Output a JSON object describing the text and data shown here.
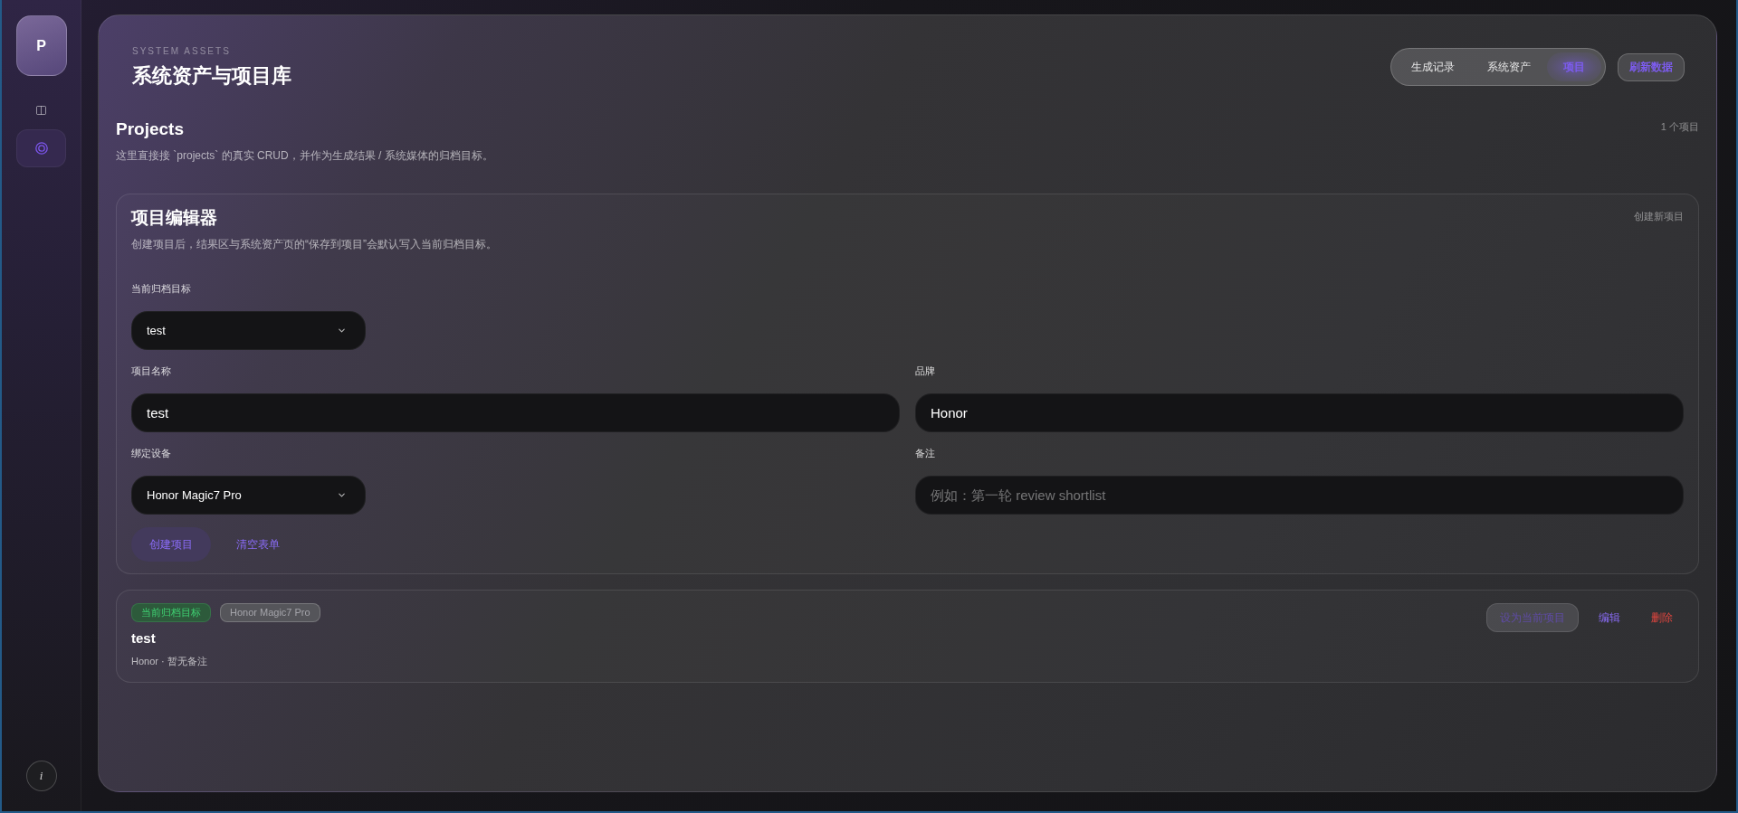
{
  "sidebar": {
    "logo": "P",
    "items": [
      {
        "kind": "columns",
        "selected": false
      },
      {
        "kind": "target",
        "selected": true
      }
    ],
    "info": "i"
  },
  "header": {
    "eyebrow": "SYSTEM ASSETS",
    "title": "系统资产与项目库",
    "tabs": [
      {
        "label": "生成记录",
        "selected": false
      },
      {
        "label": "系统资产",
        "selected": false
      },
      {
        "label": "项目",
        "selected": true
      }
    ],
    "refresh_button": "刷新数据"
  },
  "section": {
    "title": "Projects",
    "description": "这里直接接 `projects` 的真实 CRUD，并作为生成结果 / 系统媒体的归档目标。",
    "count": "1 个项目"
  },
  "editor": {
    "title": "项目编辑器",
    "description": "创建项目后，结果区与系统资产页的“保存到项目”会默认写入当前归档目标。",
    "new_link": "创建新项目",
    "archive_target": {
      "label": "当前归档目标",
      "value": "test"
    },
    "fields": [
      {
        "kind": "input",
        "label": "项目名称",
        "value": "test"
      },
      {
        "kind": "input",
        "label": "品牌",
        "value": "Honor"
      },
      {
        "kind": "select",
        "label": "绑定设备",
        "value": "Honor Magic7 Pro"
      },
      {
        "kind": "input",
        "label": "备注",
        "placeholder": "例如：第一轮 review shortlist"
      }
    ],
    "buttons": [
      {
        "kind": "primary",
        "label": "创建项目"
      },
      {
        "kind": "link",
        "label": "清空表单"
      }
    ]
  },
  "projects": [
    {
      "name": "test",
      "badges": [
        {
          "kind": "current",
          "label": "当前归档目标"
        },
        {
          "kind": "device",
          "label": "Honor Magic7 Pro"
        }
      ],
      "meta": "Honor · 暂无备注",
      "actions": [
        {
          "kind": "secondary",
          "label": "设为当前项目",
          "disabled": true
        },
        {
          "kind": "link",
          "label": "编辑",
          "disabled": false
        },
        {
          "kind": "danger",
          "label": "删除",
          "disabled": false
        }
      ]
    }
  ]
}
